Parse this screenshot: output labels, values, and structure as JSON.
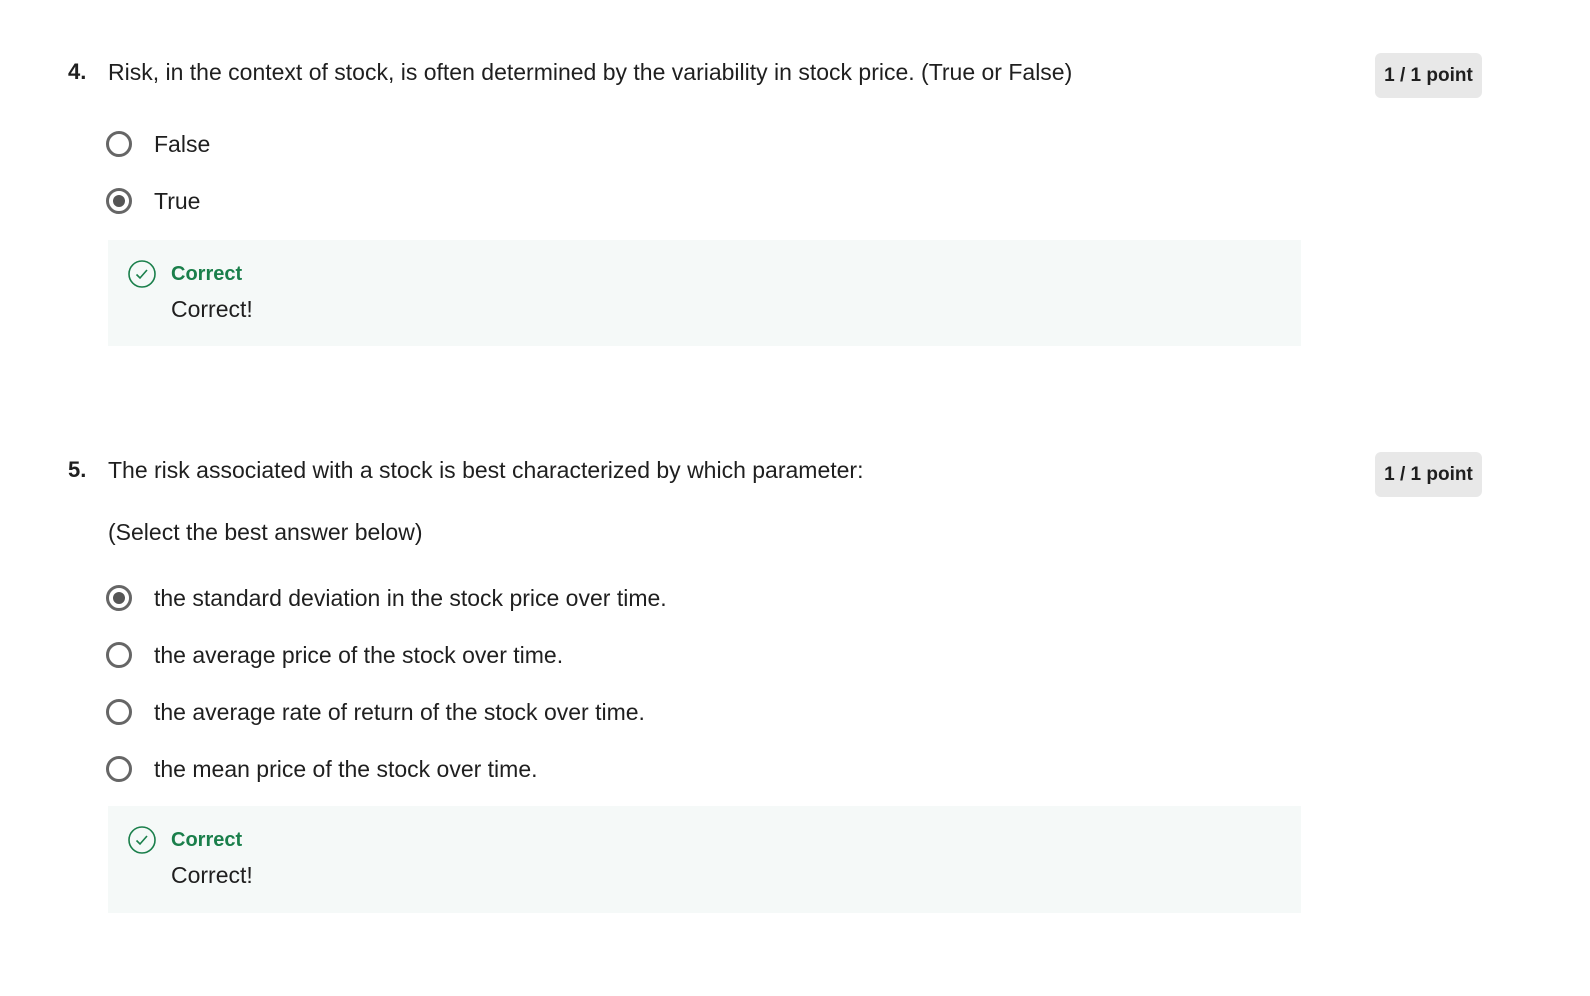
{
  "questions": [
    {
      "number": "4.",
      "text": "Risk, in the context of stock, is often determined by the variability in stock price.  (True or False)",
      "points": "1 / 1 point",
      "options": [
        {
          "label": "False",
          "selected": false
        },
        {
          "label": "True",
          "selected": true
        }
      ],
      "feedback": {
        "title": "Correct",
        "text": "Correct!"
      }
    },
    {
      "number": "5.",
      "text": "The risk associated with a stock is best characterized by which parameter:",
      "subtext": "(Select the best answer below)",
      "points": "1 / 1 point",
      "options": [
        {
          "label": "the standard deviation in the stock price over time.",
          "selected": true
        },
        {
          "label": "the average price of the stock over time.",
          "selected": false
        },
        {
          "label": "the average rate of return of the stock over time.",
          "selected": false
        },
        {
          "label": "the mean price of the stock over time.",
          "selected": false
        }
      ],
      "feedback": {
        "title": "Correct",
        "text": "Correct!"
      }
    }
  ],
  "colors": {
    "correct": "#1a7f4b",
    "feedback_bg": "#f5f9f8",
    "badge_bg": "#e8e8e8"
  }
}
